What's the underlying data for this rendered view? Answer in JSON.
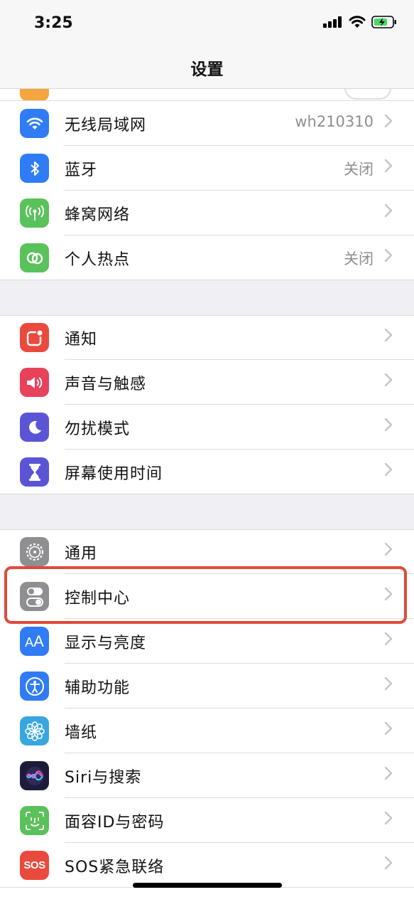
{
  "status_bar": {
    "time": "3:25",
    "icons": [
      "signal-icon",
      "wifi-icon",
      "battery-icon"
    ]
  },
  "nav": {
    "title": "设置"
  },
  "groups": [
    {
      "rows": [
        {
          "id": "wifi",
          "label": "无线局域网",
          "value": "wh210310",
          "icon": "wifi-icon",
          "color": "#2f7cf6"
        },
        {
          "id": "bluetooth",
          "label": "蓝牙",
          "value": "关闭",
          "icon": "bluetooth-icon",
          "color": "#2f7cf6"
        },
        {
          "id": "cellular",
          "label": "蜂窝网络",
          "value": "",
          "icon": "antenna-icon",
          "color": "#5ac25a"
        },
        {
          "id": "hotspot",
          "label": "个人热点",
          "value": "关闭",
          "icon": "hotspot-icon",
          "color": "#5ac25a"
        }
      ]
    },
    {
      "rows": [
        {
          "id": "notifications",
          "label": "通知",
          "value": "",
          "icon": "notification-icon",
          "color": "#ea4a3e"
        },
        {
          "id": "sounds",
          "label": "声音与触感",
          "value": "",
          "icon": "speaker-icon",
          "color": "#e8415a"
        },
        {
          "id": "dnd",
          "label": "勿扰模式",
          "value": "",
          "icon": "moon-icon",
          "color": "#5b55d6"
        },
        {
          "id": "screentime",
          "label": "屏幕使用时间",
          "value": "",
          "icon": "hourglass-icon",
          "color": "#5b55d6"
        }
      ]
    },
    {
      "rows": [
        {
          "id": "general",
          "label": "通用",
          "value": "",
          "icon": "gear-icon",
          "color": "#8e8e93"
        },
        {
          "id": "control-center",
          "label": "控制中心",
          "value": "",
          "icon": "toggles-icon",
          "color": "#8e8e93"
        },
        {
          "id": "display",
          "label": "显示与亮度",
          "value": "",
          "icon": "text-size-icon",
          "color": "#2f7cf6"
        },
        {
          "id": "accessibility",
          "label": "辅助功能",
          "value": "",
          "icon": "accessibility-icon",
          "color": "#2f7cf6"
        },
        {
          "id": "wallpaper",
          "label": "墙纸",
          "value": "",
          "icon": "flower-icon",
          "color": "#38a6e0"
        },
        {
          "id": "siri",
          "label": "Siri与搜索",
          "value": "",
          "icon": "siri-icon",
          "color": "#1c1c3a"
        },
        {
          "id": "faceid",
          "label": "面容ID与密码",
          "value": "",
          "icon": "faceid-icon",
          "color": "#5ac25a"
        },
        {
          "id": "sos",
          "label": "SOS紧急联络",
          "value": "",
          "icon": "sos-icon",
          "color": "#ea4a3e",
          "icon_text": "SOS"
        }
      ]
    }
  ],
  "highlight_row": "control-center"
}
